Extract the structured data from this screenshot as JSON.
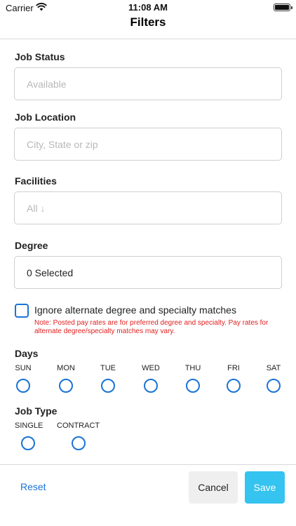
{
  "status_bar": {
    "carrier": "Carrier",
    "time": "11:08 AM"
  },
  "nav": {
    "title": "Filters"
  },
  "job_status": {
    "label": "Job Status",
    "placeholder": "Available"
  },
  "job_location": {
    "label": "Job Location",
    "placeholder": "City, State or zip"
  },
  "facilities": {
    "label": "Facilities",
    "placeholder": "All ↓"
  },
  "degree": {
    "label": "Degree",
    "value": "0 Selected"
  },
  "ignore_alternate": {
    "label": "Ignore alternate degree and specialty matches",
    "checked": false,
    "note": "Note: Posted pay rates are for preferred degree and specialty. Pay rates for alternate degree/specialty matches may vary."
  },
  "days": {
    "label": "Days",
    "items": [
      "SUN",
      "MON",
      "TUE",
      "WED",
      "THU",
      "FRI",
      "SAT"
    ]
  },
  "job_type": {
    "label": "Job Type",
    "items": [
      "SINGLE",
      "CONTRACT"
    ]
  },
  "toolbar": {
    "reset": "Reset",
    "cancel": "Cancel",
    "save": "Save"
  },
  "colors": {
    "accent": "#1a73d6",
    "save_button": "#35c3f0",
    "note": "#e02020"
  }
}
